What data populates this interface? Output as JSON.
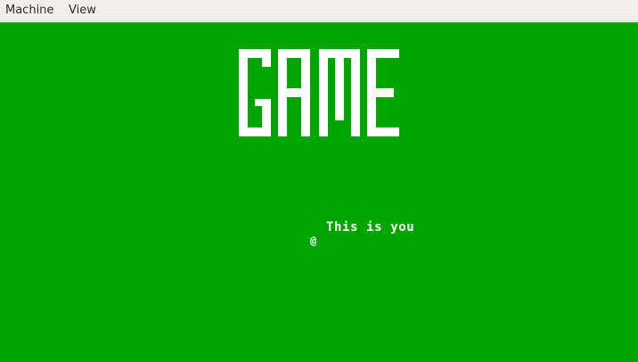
{
  "menubar": {
    "items": [
      "Machine",
      "View"
    ]
  },
  "game": {
    "title": "GAME",
    "caption": "This is you",
    "player_glyph": "@",
    "background_color": "#00a500",
    "foreground_color": "#ffffff"
  }
}
